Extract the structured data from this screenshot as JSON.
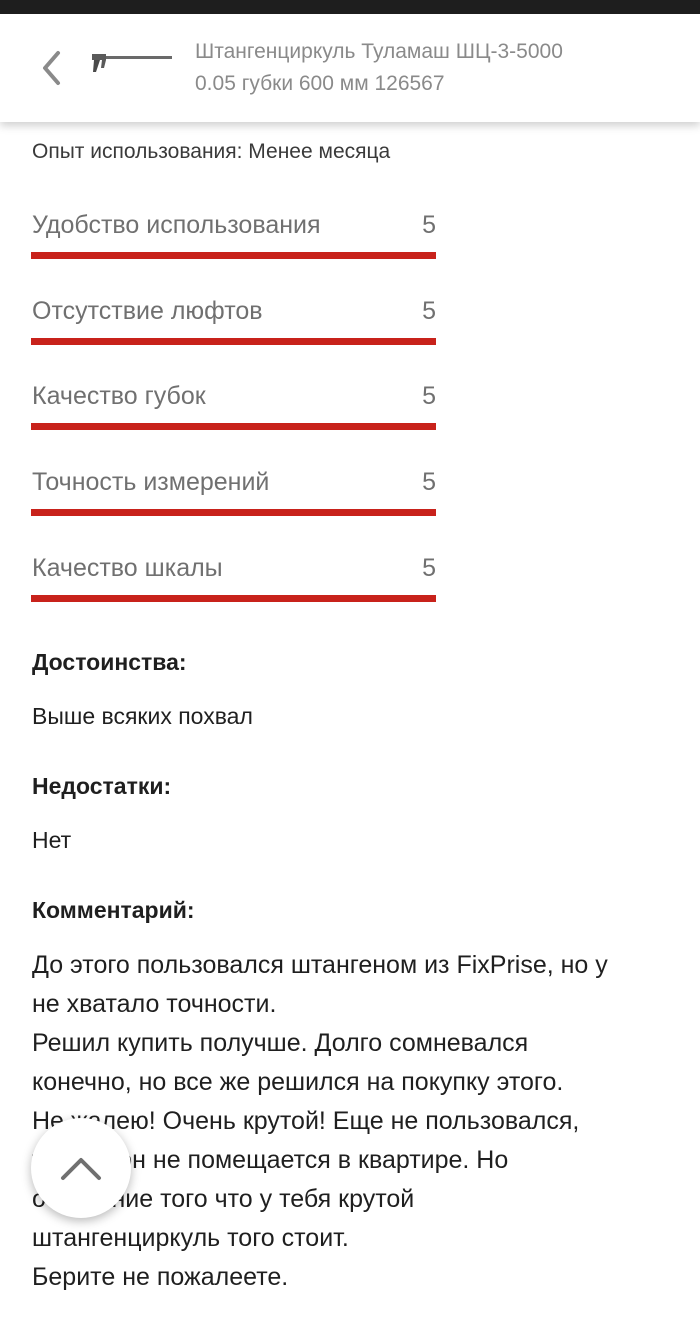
{
  "header": {
    "title_line1": "Штангенциркуль Туламаш ШЦ-3-5000",
    "title_line2": "0.05 губки 600 мм 126567"
  },
  "review": {
    "experience": "Опыт использования: Менее месяца",
    "ratings": [
      {
        "label": "Удобство использования",
        "value": "5"
      },
      {
        "label": "Отсутствие люфтов",
        "value": "5"
      },
      {
        "label": "Качество губок",
        "value": "5"
      },
      {
        "label": "Точность измерений",
        "value": "5"
      },
      {
        "label": "Качество шкалы",
        "value": "5"
      }
    ],
    "pros_heading": "Достоинства:",
    "pros_text": "Выше всяких похвал",
    "cons_heading": "Недостатки:",
    "cons_text": "Нет",
    "comment_heading": "Комментарий:",
    "comment_lines": [
      "До этого пользовался штангеном из FixPrise, но у",
      "не хватало точности.",
      "Решил купить получше. Долго сомневался",
      "конечно, но все же решился на покупку этого.",
      "Не жалею! Очень крутой! Еще не пользовался,",
      "так как он не помещается в квартире. Но",
      "осознание того что у тебя крутой",
      "штангенциркуль того стоит.",
      "Берите не пожалеете."
    ]
  },
  "colors": {
    "accent": "#c8221b",
    "muted_text": "#707070",
    "title_text": "#8a8a8a"
  },
  "icons": {
    "back": "chevron-left-icon",
    "scroll_top": "chevron-up-icon",
    "product": "caliper-image"
  }
}
